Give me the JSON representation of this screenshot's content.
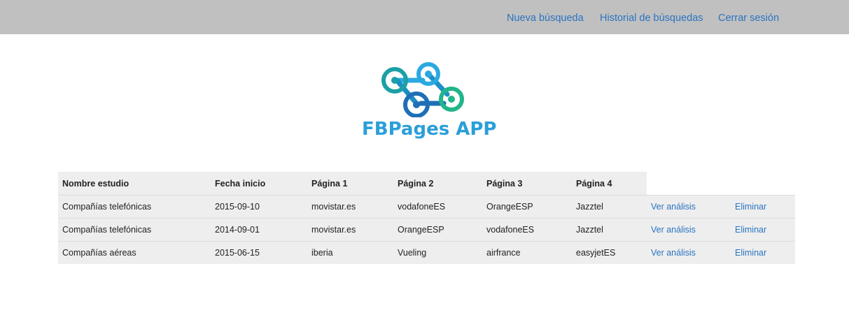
{
  "nav": {
    "new_search": "Nueva búsqueda",
    "history": "Historial de búsquedas",
    "logout": "Cerrar sesión"
  },
  "logo": {
    "text": "FBPages APP",
    "colors": [
      "#1a8fc4",
      "#2aa9e0",
      "#22b58a",
      "#1f6fb7"
    ]
  },
  "table": {
    "headers": [
      "Nombre estudio",
      "Fecha inicio",
      "Página 1",
      "Página 2",
      "Página 3",
      "Página 4",
      "",
      ""
    ],
    "rows": [
      {
        "name": "Compañías telefónicas",
        "date": "2015-09-10",
        "p1": "movistar.es",
        "p2": "vodafoneES",
        "p3": "OrangeESP",
        "p4": "Jazztel",
        "view": "Ver análisis",
        "delete": "Eliminar"
      },
      {
        "name": "Compañías telefónicas",
        "date": "2014-09-01",
        "p1": "movistar.es",
        "p2": "OrangeESP",
        "p3": "vodafoneES",
        "p4": "Jazztel",
        "view": "Ver análisis",
        "delete": "Eliminar"
      },
      {
        "name": "Compañías aéreas",
        "date": "2015-06-15",
        "p1": "iberia",
        "p2": "Vueling",
        "p3": "airfrance",
        "p4": "easyjetES",
        "view": "Ver análisis",
        "delete": "Eliminar"
      }
    ]
  },
  "colors": {
    "topbar": "#c0c0c0",
    "link": "#2a74c1",
    "table_bg": "#eeeeee"
  }
}
